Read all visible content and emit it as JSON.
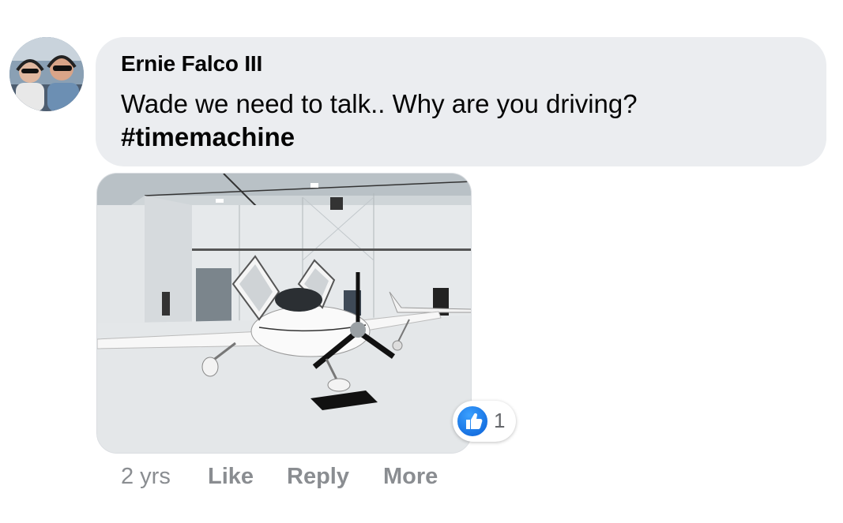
{
  "comment": {
    "author": "Ernie Falco III",
    "text": "Wade we need to talk.. Why are you driving?",
    "hashtag": "#timemachine"
  },
  "reactions": {
    "icon": "like-icon",
    "count": "1",
    "color": "#1877f2"
  },
  "actions": {
    "timestamp": "2 yrs",
    "like_label": "Like",
    "reply_label": "Reply",
    "more_label": "More"
  }
}
